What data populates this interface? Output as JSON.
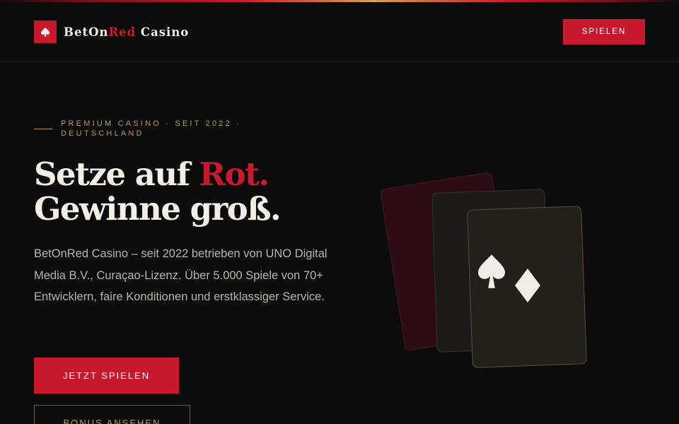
{
  "brand": {
    "name_part1": "BetOn",
    "name_part2": "Red",
    "name_part3": " Casino",
    "accent_color": "#c8192d",
    "gold_color": "#b89a4a",
    "logo_icon": "spade-icon"
  },
  "nav": {
    "play_label": "SPIELEN"
  },
  "hero": {
    "eyebrow": "PREMIUM CASINO · SEIT 2022 · DEUTSCHLAND",
    "title_line1_part1": "Setze auf ",
    "title_line1_part2": "Rot.",
    "title_line2": "Gewinne groß.",
    "description": "BetOnRed Casino – seit 2022 betrieben von UNO Digital Media B.V., Curaçao-Lizenz. Über 5.000 Spiele von 70+ Entwicklern, faire Konditionen und erstklassiger Service.",
    "cta_label": "JETZT SPIELEN",
    "bonus_label": "BONUS ANSEHEN"
  },
  "illustration": {
    "suits": [
      "spade-icon",
      "diamond-icon"
    ]
  }
}
